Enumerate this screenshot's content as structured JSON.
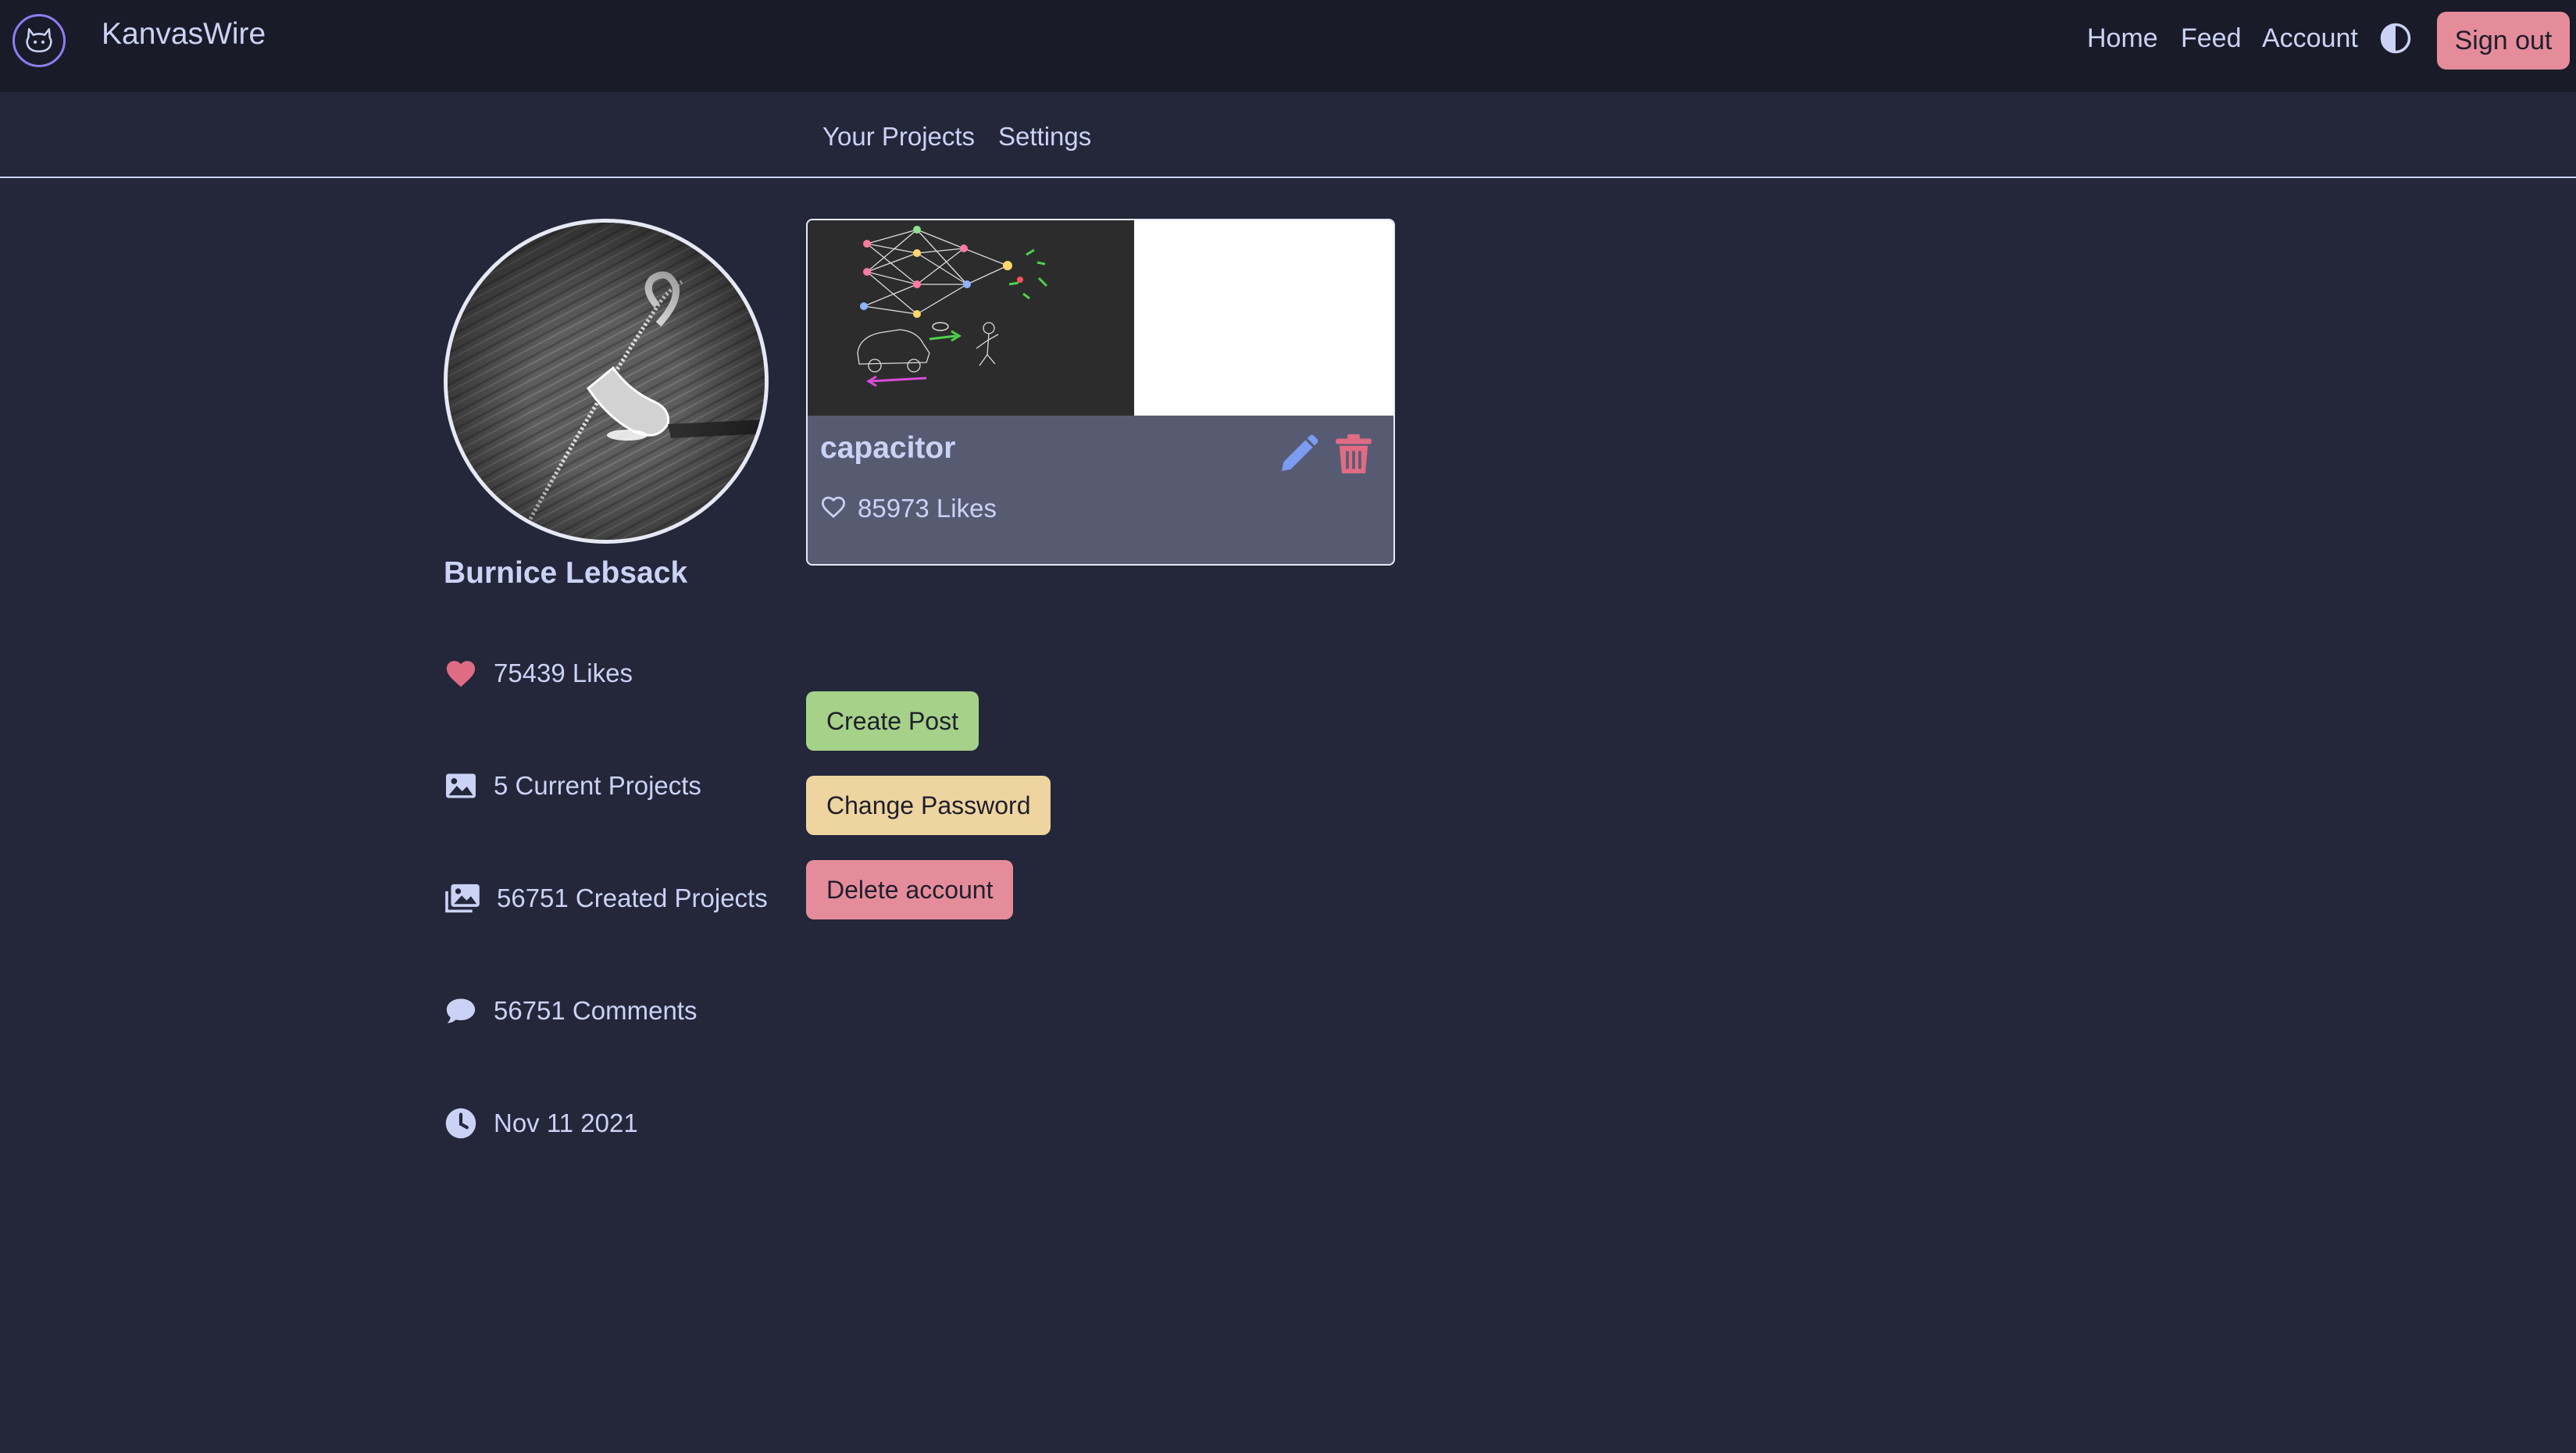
{
  "header": {
    "brand": "KanvasWire",
    "nav": [
      "Home",
      "Feed",
      "Account"
    ],
    "sign_out": "Sign out"
  },
  "subnav": [
    "Your Projects",
    "Settings"
  ],
  "profile": {
    "name": "Burnice Lebsack",
    "stats": {
      "likes": "75439 Likes",
      "current_projects": "5 Current Projects",
      "created_projects": "56751 Created Projects",
      "comments": "56751 Comments",
      "joined": "Nov 11 2021"
    }
  },
  "project_card": {
    "title": "capacitor",
    "likes": "85973 Likes"
  },
  "actions": {
    "create_post": "Create Post",
    "change_password": "Change Password",
    "delete_account": "Delete account"
  },
  "colors": {
    "background": "#24263a",
    "topbar": "#1a1b29",
    "text": "#cad3f5",
    "heart": "#e06c84",
    "edit": "#7b9cf0",
    "delete": "#e06c84",
    "create": "#a6d189",
    "change_password": "#eed49f",
    "delete_account": "#e58c9b"
  },
  "icons": {
    "logo": "github-cat-icon",
    "theme": "half-circle-icon",
    "likes": "heart-icon",
    "current": "image-icon",
    "created": "images-icon",
    "comments": "comment-icon",
    "joined": "clock-icon",
    "card_like": "heart-outline-icon",
    "edit": "pencil-icon",
    "delete": "trash-icon"
  }
}
